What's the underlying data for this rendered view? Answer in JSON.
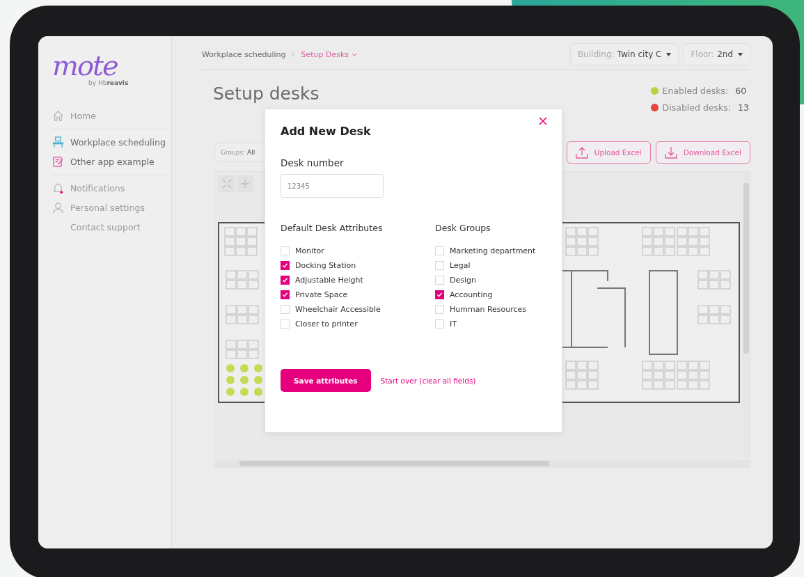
{
  "logo": {
    "wordmark": "mote",
    "byline": "by Hb**reavis**"
  },
  "sidebar": {
    "sections": [
      [
        {
          "label": "Home",
          "kind": "home"
        }
      ],
      [
        {
          "label": "Workplace scheduling",
          "kind": "desk"
        },
        {
          "label": "Other app example",
          "kind": "note"
        }
      ],
      [
        {
          "label": "Notifications",
          "kind": "bell"
        },
        {
          "label": "Personal settings",
          "kind": "person"
        },
        {
          "label": "Contact support",
          "kind": "plain"
        }
      ]
    ]
  },
  "breadcrumb": [
    {
      "label": "Workplace scheduling",
      "current": false
    },
    {
      "label": "Setup Desks",
      "current": true
    }
  ],
  "selectors": [
    {
      "label": "Building:",
      "value": "Twin city C"
    },
    {
      "label": "Floor:",
      "value": "2nd"
    }
  ],
  "title": "Setup desks",
  "stats": [
    {
      "label": "Enabled desks:",
      "count": "60",
      "color": "#b9d43c"
    },
    {
      "label": "Disabled desks:",
      "count": "13",
      "color": "#e5463f"
    }
  ],
  "groups_filter": {
    "label": "Groups:",
    "value": "All"
  },
  "buttons": [
    {
      "label": "Upload Excel",
      "kind": "upload"
    },
    {
      "label": "Download Excel",
      "kind": "download"
    }
  ],
  "modal": {
    "title": "Add New Desk",
    "field_label": "Desk number",
    "field_value": "12345",
    "columns": [
      {
        "heading": "Default Desk Attributes",
        "options": [
          {
            "label": "Monitor",
            "checked": false
          },
          {
            "label": "Docking Station",
            "checked": true
          },
          {
            "label": "Adjustable Height",
            "checked": true
          },
          {
            "label": "Private Space",
            "checked": true
          },
          {
            "label": "Wheelchair Accessible",
            "checked": false
          },
          {
            "label": "Closer to printer",
            "checked": false
          }
        ]
      },
      {
        "heading": "Desk Groups",
        "options": [
          {
            "label": "Marketing department",
            "checked": false
          },
          {
            "label": "Legal",
            "checked": false
          },
          {
            "label": "Design",
            "checked": false
          },
          {
            "label": "Accounting",
            "checked": true
          },
          {
            "label": "Humman Resources",
            "checked": false
          },
          {
            "label": "IT",
            "checked": false
          }
        ]
      }
    ],
    "primary": "Save attributes",
    "link": "Start over (clear all fields)"
  }
}
